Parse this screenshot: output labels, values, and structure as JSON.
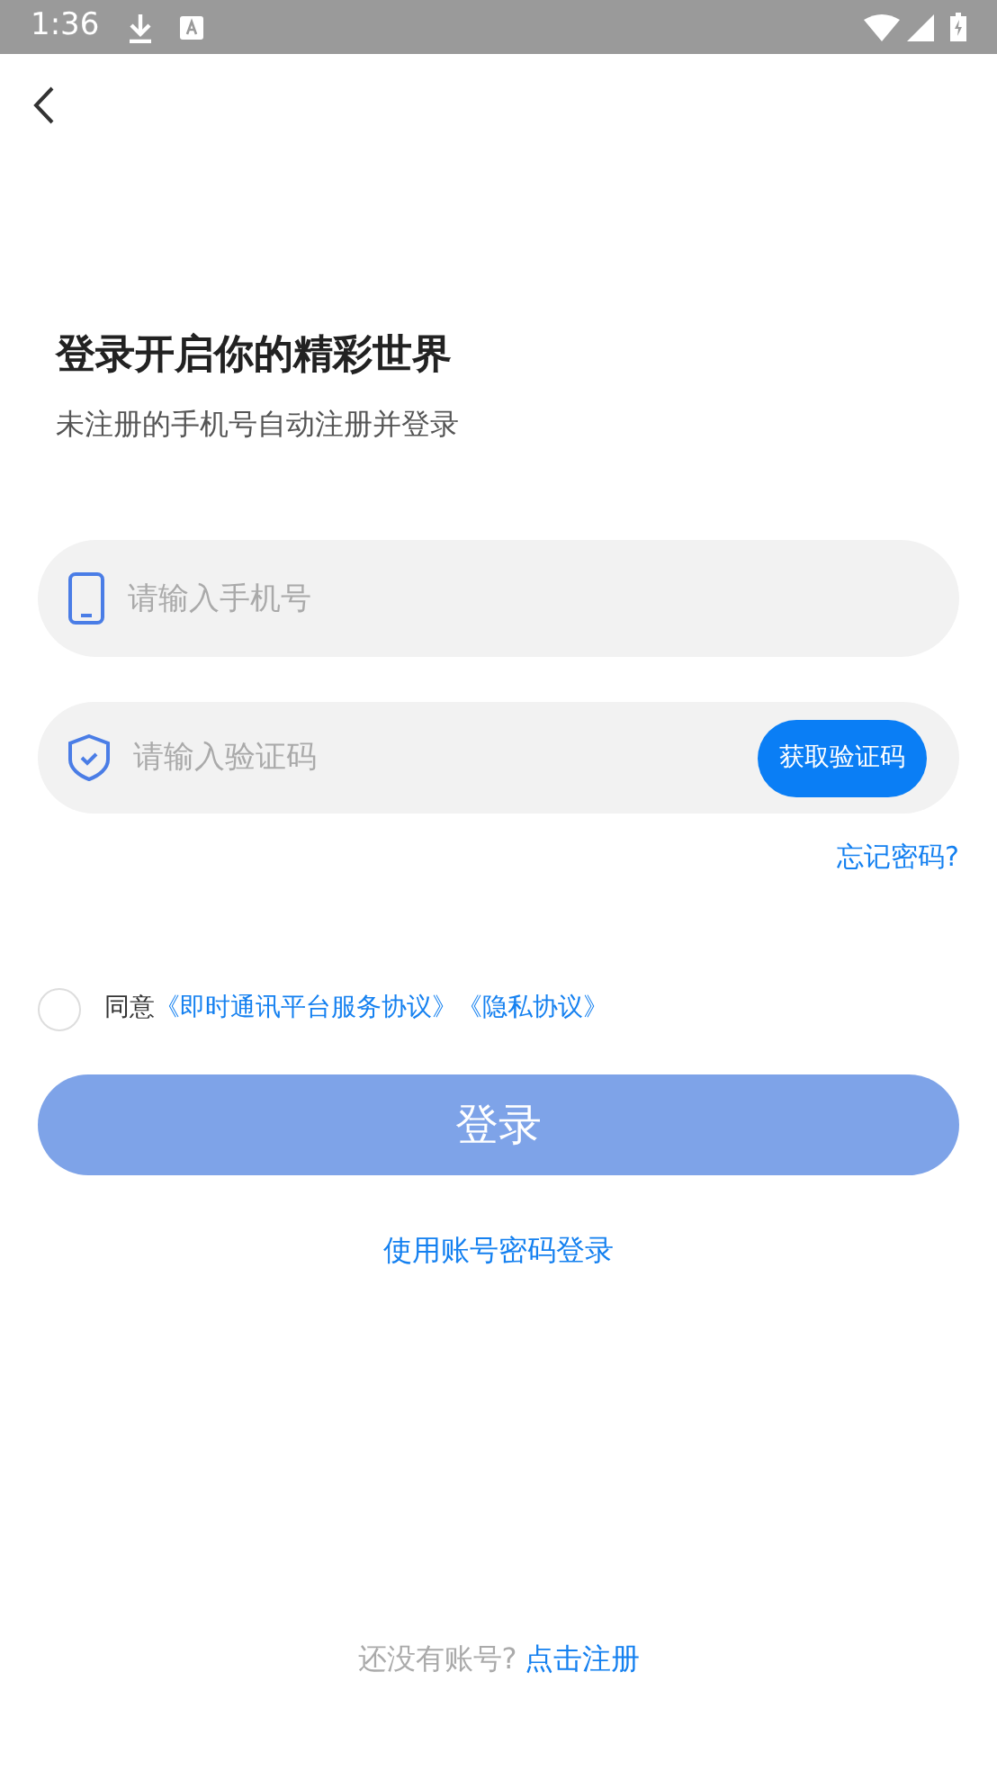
{
  "status_bar": {
    "time": "1:36"
  },
  "title": "登录开启你的精彩世界",
  "subtitle": "未注册的手机号自动注册并登录",
  "phone_field": {
    "placeholder": "请输入手机号"
  },
  "code_field": {
    "placeholder": "请输入验证码",
    "button": "获取验证码"
  },
  "forgot_password": "忘记密码?",
  "agreement": {
    "checked": false,
    "prefix": "同意",
    "links": [
      "《即时通讯平台服务协议》",
      "《隐私协议》"
    ]
  },
  "login_button": {
    "label": "登录",
    "disabled": true
  },
  "alt_login": "使用账号密码登录",
  "register": {
    "prompt": "还没有账号?",
    "link": "点击注册"
  }
}
